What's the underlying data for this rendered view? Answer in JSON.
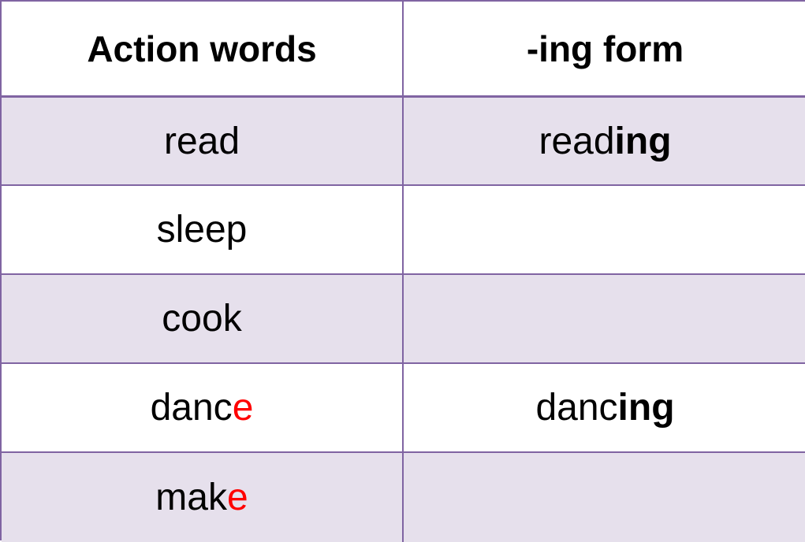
{
  "colors": {
    "border": "#8064a2",
    "band_shade": "#e6e0ec",
    "highlight_letter": "#ff0000"
  },
  "table": {
    "headers": [
      "Action words",
      "-ing form"
    ],
    "rows": [
      {
        "action": {
          "stem": "read",
          "highlight": ""
        },
        "ing_form": {
          "stem": "read",
          "suffix": "ing"
        }
      },
      {
        "action": {
          "stem": "sleep",
          "highlight": ""
        },
        "ing_form": {
          "stem": "",
          "suffix": ""
        }
      },
      {
        "action": {
          "stem": "cook",
          "highlight": ""
        },
        "ing_form": {
          "stem": "",
          "suffix": ""
        }
      },
      {
        "action": {
          "stem": "danc",
          "highlight": "e"
        },
        "ing_form": {
          "stem": "danc",
          "suffix": "ing"
        }
      },
      {
        "action": {
          "stem": "mak",
          "highlight": "e"
        },
        "ing_form": {
          "stem": "",
          "suffix": ""
        }
      }
    ]
  }
}
